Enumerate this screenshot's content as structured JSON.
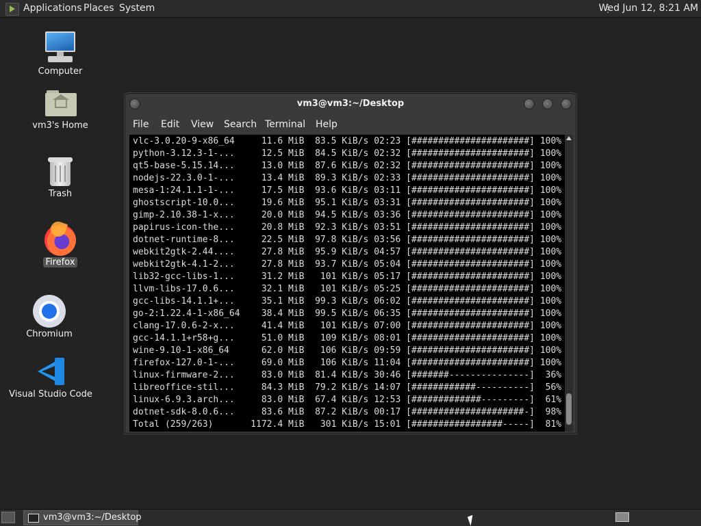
{
  "top_panel": {
    "menus": [
      "Applications",
      "Places",
      "System"
    ],
    "clock": "Wed Jun 12,  8:21 AM"
  },
  "desktop_icons": [
    {
      "label": "Computer",
      "icon": "computer-icon"
    },
    {
      "label": "vm3's Home",
      "icon": "home-folder-icon"
    },
    {
      "label": "Trash",
      "icon": "trash-icon"
    },
    {
      "label": "Firefox",
      "icon": "firefox-icon"
    },
    {
      "label": "Chromium",
      "icon": "chromium-icon"
    },
    {
      "label": "Visual Studio Code",
      "icon": "vscode-icon"
    }
  ],
  "terminal": {
    "title": "vm3@vm3:~/Desktop",
    "menu": [
      "File",
      "Edit",
      "View",
      "Search",
      "Terminal",
      "Help"
    ],
    "lines": [
      "vlc-3.0.20-9-x86_64     11.6 MiB  83.5 KiB/s 02:23 [######################] 100%",
      "python-3.12.3-1-...     12.5 MiB  84.5 KiB/s 02:32 [######################] 100%",
      "qt5-base-5.15.14...     13.0 MiB  87.6 KiB/s 02:32 [######################] 100%",
      "nodejs-22.3.0-1-...     13.4 MiB  89.3 KiB/s 02:33 [######################] 100%",
      "mesa-1:24.1.1-1-...     17.5 MiB  93.6 KiB/s 03:11 [######################] 100%",
      "ghostscript-10.0...     19.6 MiB  95.1 KiB/s 03:31 [######################] 100%",
      "gimp-2.10.38-1-x...     20.0 MiB  94.5 KiB/s 03:36 [######################] 100%",
      "papirus-icon-the...     20.8 MiB  92.3 KiB/s 03:51 [######################] 100%",
      "dotnet-runtime-8...     22.5 MiB  97.8 KiB/s 03:56 [######################] 100%",
      "webkit2gtk-2.44....     27.8 MiB  95.9 KiB/s 04:57 [######################] 100%",
      "webkit2gtk-4.1-2...     27.8 MiB  93.7 KiB/s 05:04 [######################] 100%",
      "lib32-gcc-libs-1...     31.2 MiB   101 KiB/s 05:17 [######################] 100%",
      "llvm-libs-17.0.6...     32.1 MiB   101 KiB/s 05:25 [######################] 100%",
      "gcc-libs-14.1.1+...     35.1 MiB  99.3 KiB/s 06:02 [######################] 100%",
      "go-2:1.22.4-1-x86_64    38.4 MiB  99.5 KiB/s 06:35 [######################] 100%",
      "clang-17.0.6-2-x...     41.4 MiB   101 KiB/s 07:00 [######################] 100%",
      "gcc-14.1.1+r58+g...     51.0 MiB   109 KiB/s 08:01 [######################] 100%",
      "wine-9.10-1-x86_64      62.0 MiB   106 KiB/s 09:59 [######################] 100%",
      "firefox-127.0-1-...     69.0 MiB   106 KiB/s 11:04 [######################] 100%",
      "linux-firmware-2...     83.0 MiB  81.4 KiB/s 30:46 [#######---------------]  36%",
      "libreoffice-stil...     84.3 MiB  79.2 KiB/s 14:07 [############----------]  56%",
      "linux-6.9.3.arch...     83.0 MiB  67.4 KiB/s 12:53 [#############---------]  61%",
      "dotnet-sdk-8.0.6...     83.6 MiB  87.2 KiB/s 00:17 [#####################-]  98%",
      "Total (259/263)       1172.4 MiB   301 KiB/s 15:01 [#################-----]  81%"
    ]
  },
  "taskbar": {
    "task_label": "vm3@vm3:~/Desktop"
  }
}
